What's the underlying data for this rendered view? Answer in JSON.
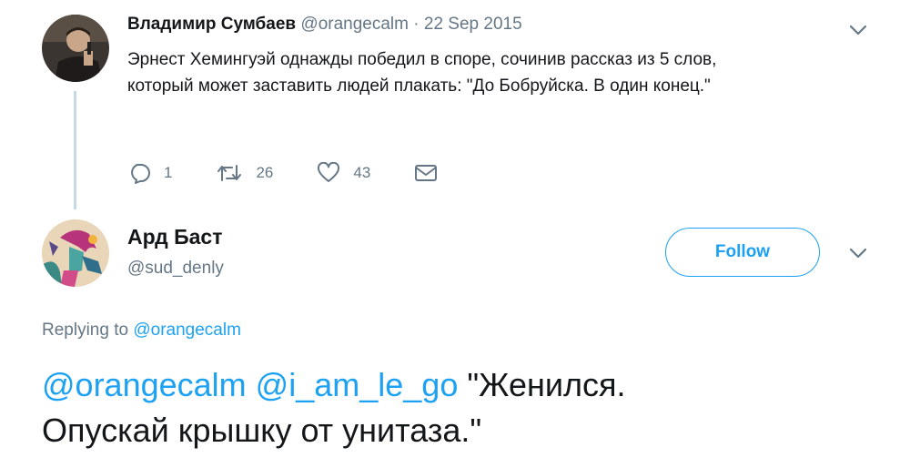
{
  "tweet1": {
    "author_name": "Владимир Сумбаев",
    "author_handle": "@orangecalm",
    "separator": "·",
    "date": "22 Sep 2015",
    "text_line1": "Эрнест Хемингуэй однажды победил в споре, сочинив рассказ из 5 слов,",
    "text_line2": "который может заставить людей плакать: \"До Бобруйска. В один конец.\"",
    "reply_count": "1",
    "retweet_count": "26",
    "like_count": "43",
    "icons": [
      "chevron-down-icon",
      "reply-icon",
      "retweet-icon",
      "heart-icon",
      "envelope-icon"
    ]
  },
  "tweet2": {
    "author_name": "Ард Баст",
    "author_handle": "@sud_denly",
    "follow_label": "Follow",
    "replying_prefix": "Replying to",
    "replying_handle": "@orangecalm",
    "mention1": "@orangecalm",
    "mention2": "@i_am_le_go",
    "text_line1": "\"Женился.",
    "text_line2": "Опускай крышку от унитаза.\""
  },
  "colors": {
    "accent": "#1da1f2",
    "secondary_text": "#657786",
    "primary_text": "#14171a",
    "thread_line": "#c4d8e8"
  }
}
